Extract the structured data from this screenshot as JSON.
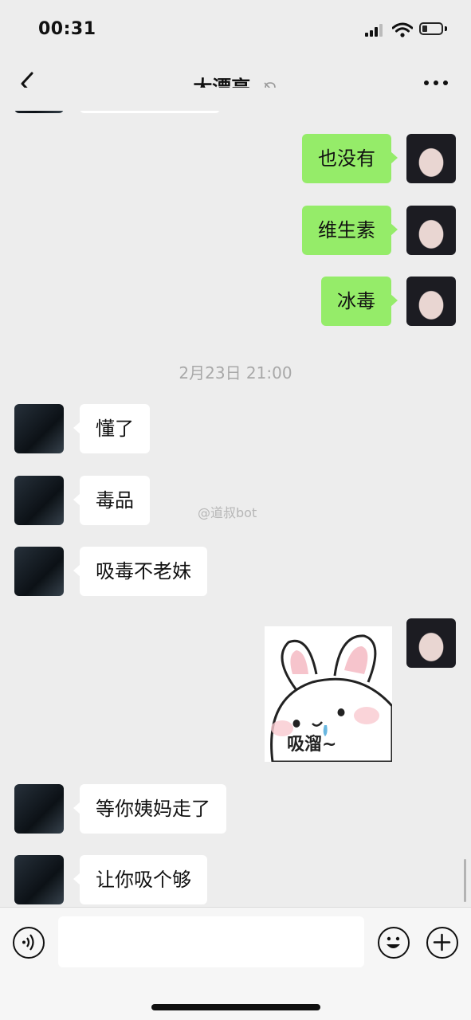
{
  "status_bar": {
    "time": "00:31"
  },
  "chat": {
    "title": "大漂亮",
    "muted": true,
    "timestamp": "2月23日 21:00",
    "messages": [
      {
        "from": "me",
        "text": "也没有"
      },
      {
        "from": "me",
        "text": "维生素"
      },
      {
        "from": "me",
        "text": "冰毒"
      },
      {
        "from": "them",
        "text": "懂了"
      },
      {
        "from": "them",
        "text": "毒品"
      },
      {
        "from": "them",
        "text": "吸毒不老妹"
      },
      {
        "from": "me",
        "type": "sticker",
        "sticker_text": "吸溜~"
      },
      {
        "from": "them",
        "text": "等你姨妈走了"
      },
      {
        "from": "them",
        "text": "让你吸个够"
      }
    ]
  },
  "watermark": "@道叔bot",
  "input": {
    "value": ""
  },
  "colors": {
    "outgoing_bubble": "#95ec69",
    "incoming_bubble": "#ffffff",
    "background": "#ededed"
  }
}
